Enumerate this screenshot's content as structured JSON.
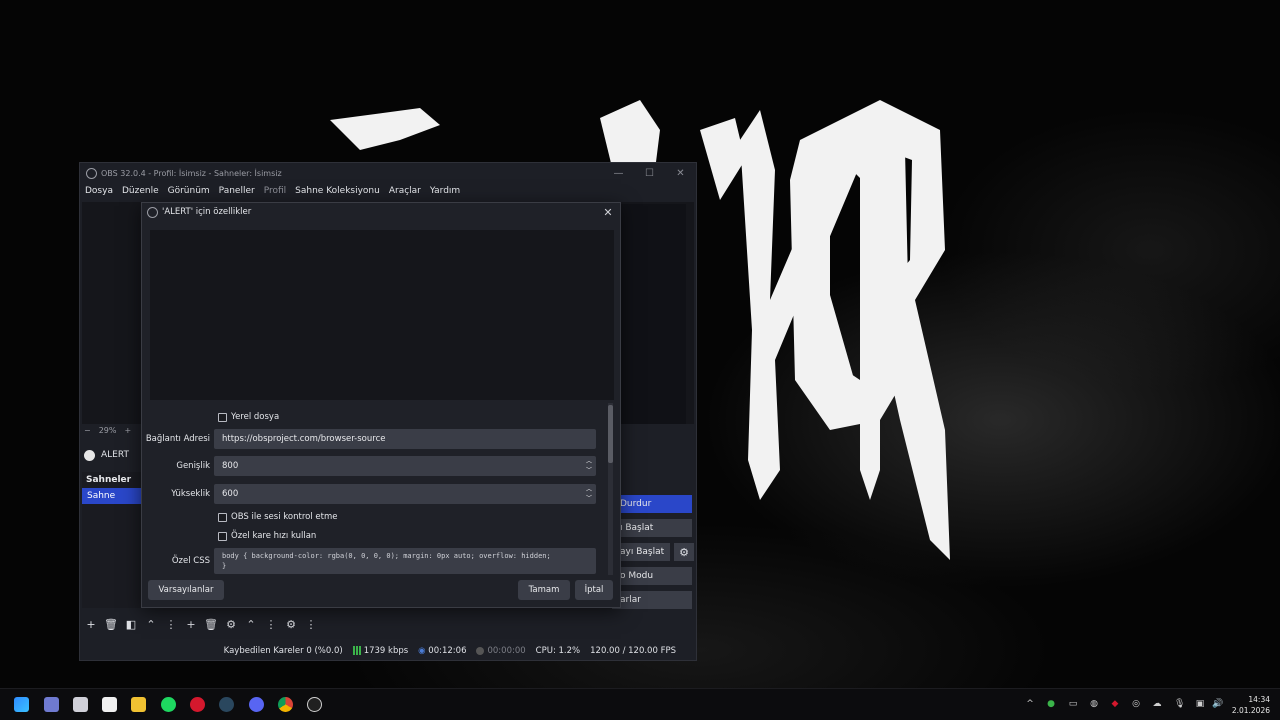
{
  "wallpaper": {
    "logo_text": "SAVVKOR"
  },
  "obs": {
    "window_title": "OBS 32.0.4 - Profil: İsimsiz - Sahneler: İsimsiz",
    "window_controls": [
      "—",
      "☐",
      "✕"
    ],
    "menu": [
      "Dosya",
      "Düzenle",
      "Görünüm",
      "Paneller",
      "Profil",
      "Sahne Koleksiyonu",
      "Araçlar",
      "Yardım"
    ],
    "zoom_minus": "−",
    "zoom_level": "29%",
    "zoom_plus": "+",
    "source_name": "ALERT",
    "scenes_title": "Sahneler",
    "scene_item": "Sahne",
    "controls": {
      "stop": "Durdur",
      "start_1": "ı Başlat",
      "start_2": "ayı Başlat",
      "mode": "o Modu",
      "settings": "arlar"
    },
    "status": {
      "dropped": "Kaybedilen Kareler 0 (%0.0)",
      "bitrate": "1739 kbps",
      "stream_time": "00:12:06",
      "rec_time": "00:00:00",
      "cpu": "CPU: 1.2%",
      "fps": "120.00 / 120.00 FPS"
    }
  },
  "dialog": {
    "title": "'ALERT' için özellikler",
    "close": "✕",
    "local_file_label": "Yerel dosya",
    "url_label": "Bağlantı Adresi",
    "url_value": "https://obsproject.com/browser-source",
    "width_label": "Genişlik",
    "width_value": "800",
    "height_label": "Yükseklik",
    "height_value": "600",
    "audio_label": "OBS ile sesi kontrol etme",
    "fps_label": "Özel kare hızı kullan",
    "css_label": "Özel CSS",
    "css_value": "body { background-color: rgba(0, 0, 0, 0); margin: 0px auto; overflow: hidden; \n}",
    "defaults_button": "Varsayılanlar",
    "ok_button": "Tamam",
    "cancel_button": "İptal"
  },
  "taskbar": {
    "time": "14:34",
    "date": "2.01.2026"
  },
  "colors": {
    "accent": "#2a47c9",
    "panel": "#1d1f26",
    "field": "#3a3d47"
  }
}
